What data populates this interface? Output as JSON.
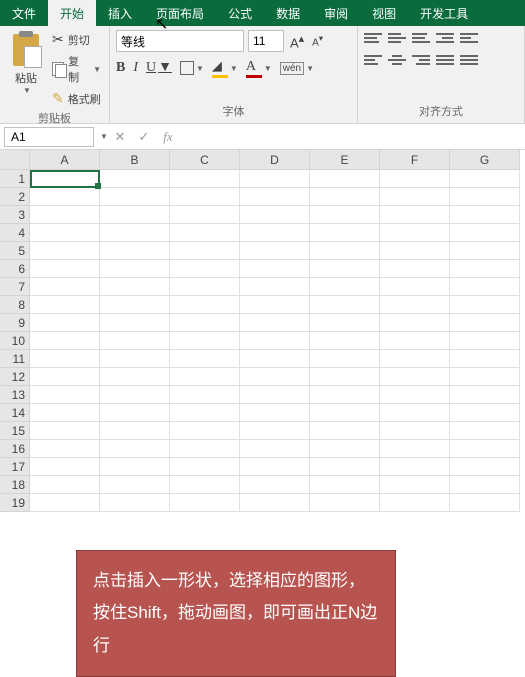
{
  "tabs": [
    "文件",
    "开始",
    "插入",
    "页面布局",
    "公式",
    "数据",
    "审阅",
    "视图",
    "开发工具"
  ],
  "active_tab": 1,
  "clipboard": {
    "paste": "粘贴",
    "cut": "剪切",
    "copy": "复制",
    "format_painter": "格式刷",
    "group_label": "剪贴板"
  },
  "font": {
    "name": "等线",
    "size": "11",
    "bold": "B",
    "italic": "I",
    "underline": "U",
    "wen": "wén",
    "group_label": "字体"
  },
  "align": {
    "group_label": "对齐方式"
  },
  "formula_bar": {
    "name_box": "A1",
    "cancel": "✕",
    "confirm": "✓",
    "fx": "fx",
    "value": ""
  },
  "columns": [
    "A",
    "B",
    "C",
    "D",
    "E",
    "F",
    "G"
  ],
  "rows": [
    "1",
    "2",
    "3",
    "4",
    "5",
    "6",
    "7",
    "8",
    "9",
    "10",
    "11",
    "12",
    "13",
    "14",
    "15",
    "16",
    "17",
    "18",
    "19"
  ],
  "callout_text": "点击插入一形状，选择相应的图形，按住Shift，拖动画图，即可画出正N边行"
}
